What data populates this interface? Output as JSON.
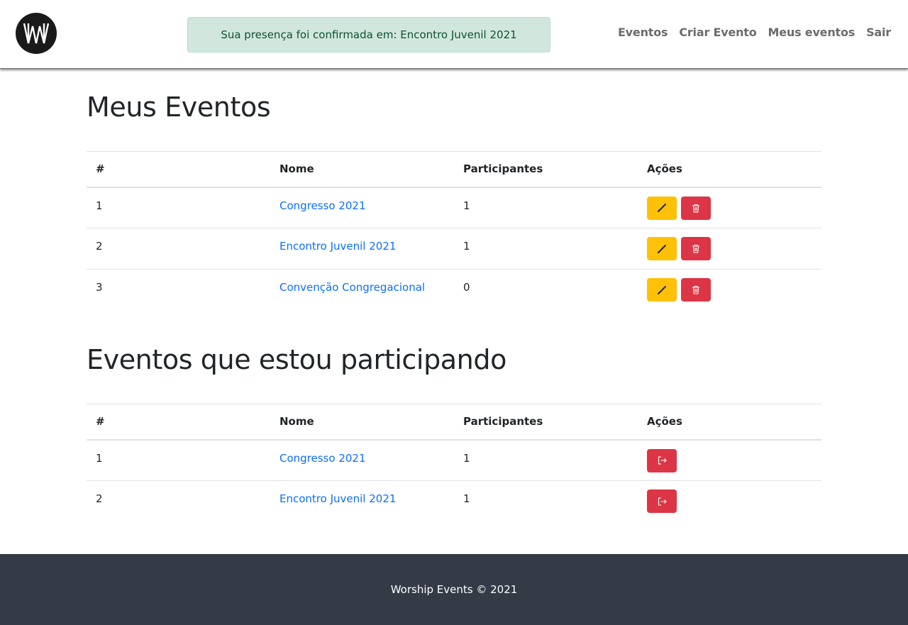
{
  "header": {
    "logo_name": "worship-events-logo",
    "alert": "Sua presença foi confirmada em: Encontro Juvenil 2021",
    "nav": [
      "Eventos",
      "Criar Evento",
      "Meus eventos",
      "Sair"
    ]
  },
  "my_events": {
    "title": "Meus Eventos",
    "columns": [
      "#",
      "Nome",
      "Participantes",
      "Ações"
    ],
    "rows": [
      {
        "num": "1",
        "name": "Congresso 2021",
        "participants": "1"
      },
      {
        "num": "2",
        "name": "Encontro Juvenil 2021",
        "participants": "1"
      },
      {
        "num": "3",
        "name": "Convenção Congregacional",
        "participants": "0"
      }
    ],
    "actions": [
      "pencil-icon",
      "trash-icon"
    ]
  },
  "participating": {
    "title": "Eventos que estou participando",
    "columns": [
      "#",
      "Nome",
      "Participantes",
      "Ações"
    ],
    "rows": [
      {
        "num": "1",
        "name": "Congresso 2021",
        "participants": "1"
      },
      {
        "num": "2",
        "name": "Encontro Juvenil 2021",
        "participants": "1"
      }
    ],
    "actions": [
      "exit-icon"
    ]
  },
  "footer": {
    "text": "Worship Events © 2021"
  },
  "colors": {
    "warning": "#ffc107",
    "danger": "#dc3545",
    "link": "#0d6efd",
    "footer_bg": "#343a46",
    "alert_bg": "#d1e7dd"
  }
}
